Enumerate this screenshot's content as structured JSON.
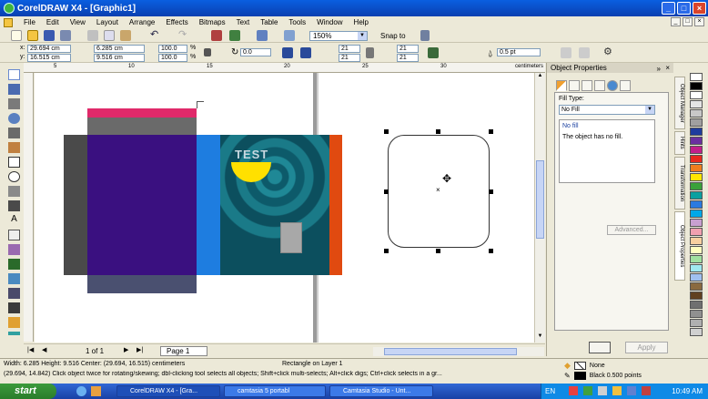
{
  "window": {
    "title": "CorelDRAW X4 - [Graphic1]"
  },
  "menu": [
    "File",
    "Edit",
    "View",
    "Layout",
    "Arrange",
    "Effects",
    "Bitmaps",
    "Text",
    "Table",
    "Tools",
    "Window",
    "Help"
  ],
  "toolbar": {
    "zoom": "150%",
    "snap_to": "Snap to",
    "x": "29.694 cm",
    "y": "16.515 cm",
    "width": "6.285 cm",
    "height": "9.516 cm",
    "scale_x": "100.0",
    "scale_y": "100.0",
    "percent": "%",
    "rotation": "0.0",
    "corner_1": "21",
    "corner_2": "21",
    "corner_3": "21",
    "corner_4": "21",
    "outline_width": "0.5 pt"
  },
  "ruler": {
    "ticks": [
      "5",
      "10",
      "15",
      "20",
      "25",
      "30"
    ],
    "unit": "centimeters",
    "v_unit": "centimeters"
  },
  "canvas": {
    "artwork_text": "TEST"
  },
  "docker": {
    "title": "Object Properties",
    "fill_type_label": "Fill Type:",
    "fill_type_value": "No Fill",
    "info_title": "No fill",
    "info_text": "The object has no fill.",
    "advanced_label": "Advanced...",
    "apply_label": "Apply",
    "side_tabs": [
      "Object Manager",
      "Hints",
      "Transformation",
      "Object Properties"
    ]
  },
  "page_nav": {
    "page_count": "1 of 1",
    "page_tab": "Page 1"
  },
  "status": {
    "dimensions": "Width: 6.285  Height: 9.516  Center: (29.694, 16.515)  centimeters",
    "object_info": "Rectangle on Layer 1",
    "hint": "(29.694, 14.842)  Click object twice for rotating/skewing; dbl-clicking tool selects all objects; Shift+click multi-selects; Alt+click digs; Ctrl+click selects in a gr...",
    "fill": "None",
    "outline": "Black  0.500 points"
  },
  "taskbar": {
    "start": "start",
    "tasks": [
      "CorelDRAW X4 - [Gra...",
      "camtasia 5 portabl",
      "Camtasia Studio - Unt..."
    ],
    "lang": "EN",
    "time": "10:49 AM"
  },
  "palette": [
    "#ffffff",
    "#000000",
    "#ffffff",
    "#e4e4e4",
    "#c8c8c8",
    "#a0a0a0",
    "#1e3c9e",
    "#6b2fa0",
    "#c21f8a",
    "#e8281e",
    "#f07d1e",
    "#ffe600",
    "#3aa13a",
    "#0aa0a0",
    "#2a7ae0",
    "#00a8e8",
    "#c8a0d0",
    "#f0a0b0",
    "#f8d0a0",
    "#ffffc0",
    "#a0e0a0",
    "#a0e8f0",
    "#a0c0f0",
    "#8a6a40",
    "#604020",
    "#707070",
    "#909090",
    "#b0b0b0",
    "#d0d0d0"
  ],
  "colors": {
    "title_bar": "#0a5fe0",
    "page_bg": "#ffffff",
    "pink_strip": "#e02a6a",
    "gray_block": "#5a5a5a",
    "purple_panel": "#3a1080",
    "blue_stripe": "#1e7de0",
    "teal_bg": "#0d5a6a",
    "orange_bar": "#e04a10",
    "yellow_moon": "#ffe000",
    "slate_bottom": "#4a5070"
  }
}
